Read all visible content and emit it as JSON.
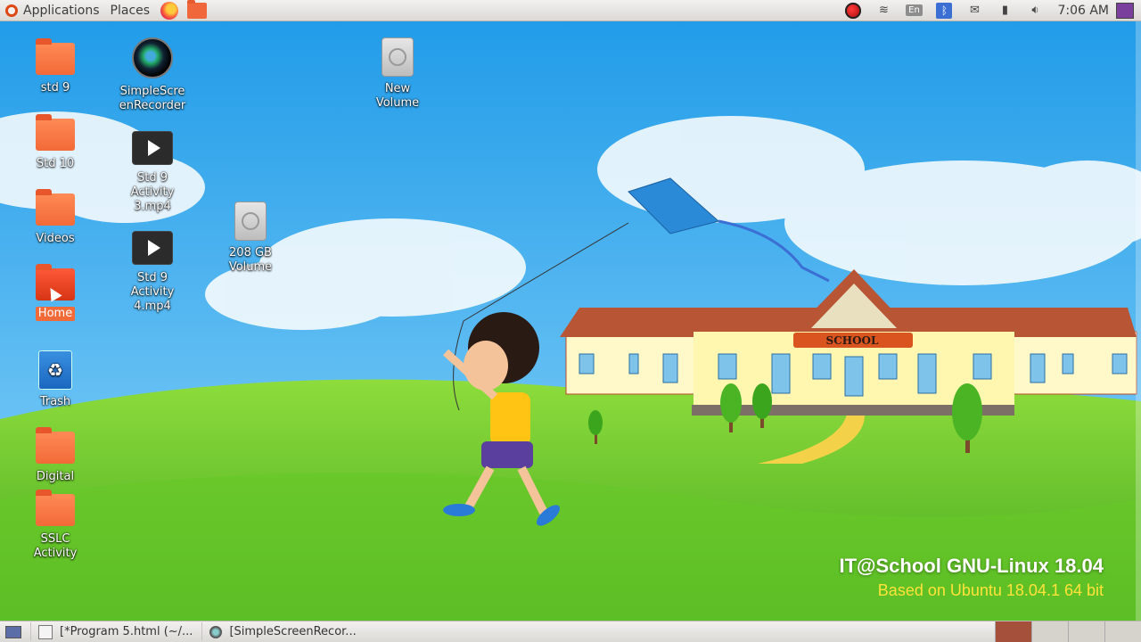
{
  "top_panel": {
    "applications_label": "Applications",
    "places_label": "Places",
    "keyboard_layout": "En",
    "clock": "7:06 AM"
  },
  "desktop_icons": {
    "std9": "std 9",
    "std10": "Std 10",
    "videos": "Videos",
    "home": "Home",
    "trash": "Trash",
    "digital": "Digital",
    "sslc": "SSLC Activity",
    "ssr": "SimpleScreenRecorder",
    "video1": "Std 9 Activity 3.mp4",
    "video2": "Std 9 Activity 4.mp4",
    "disk208": "208 GB Volume",
    "newvol": "New Volume"
  },
  "wallpaper": {
    "school_sign": "SCHOOL",
    "brand_line1": "IT@School GNU-Linux 18.04",
    "brand_line2": "Based on Ubuntu 18.04.1  64 bit"
  },
  "taskbar": {
    "task1": "[*Program 5.html (~/...",
    "task2": "[SimpleScreenRecor..."
  },
  "colors": {
    "sky": "#3aaef0",
    "grass": "#5ec62e",
    "accent": "#f26a38"
  }
}
